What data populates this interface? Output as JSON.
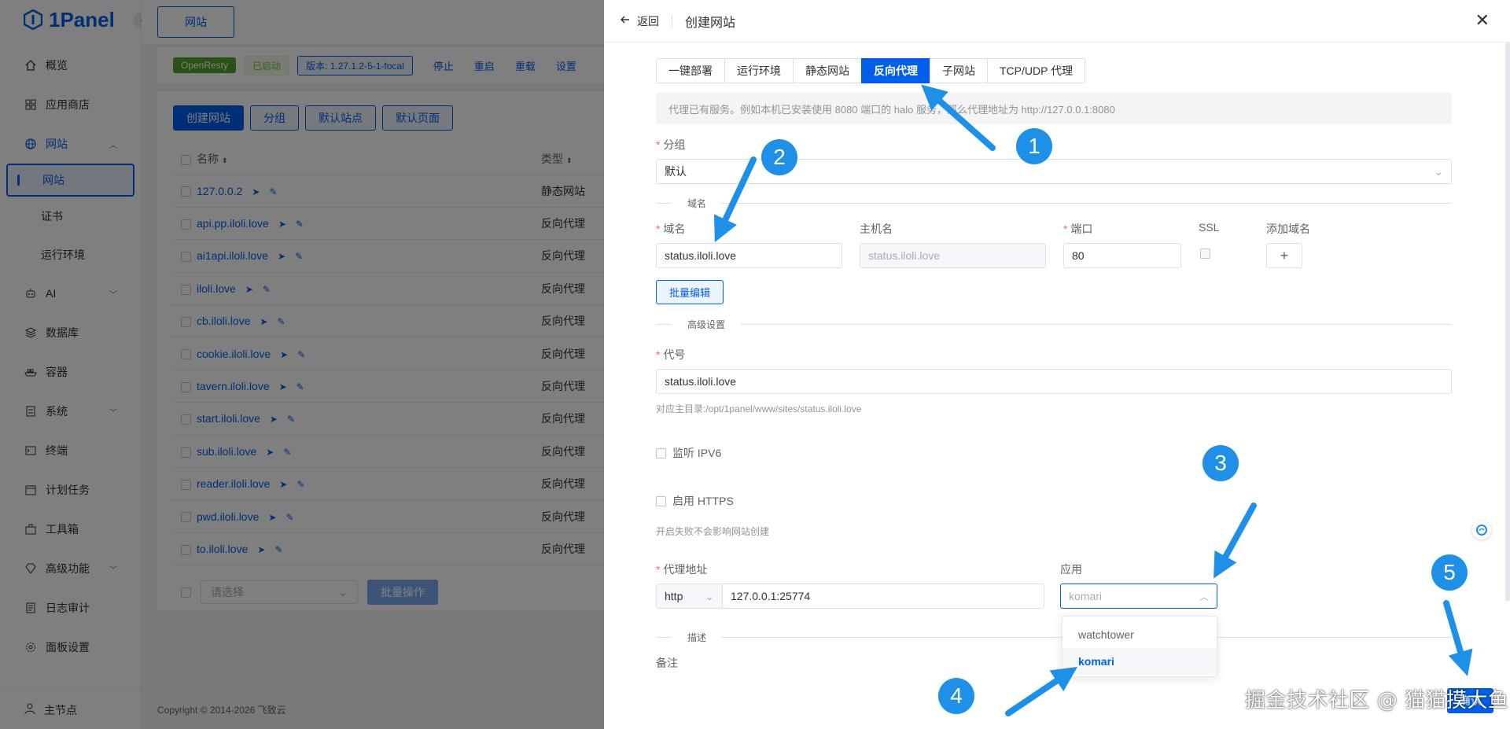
{
  "app": {
    "logo_text": "1Panel",
    "copyright": "Copyright © 2014-2026 飞致云"
  },
  "sidebar": {
    "items": [
      {
        "label": "概览",
        "icon": "home-icon"
      },
      {
        "label": "应用商店",
        "icon": "grid-icon"
      },
      {
        "label": "网站",
        "icon": "globe-icon"
      },
      {
        "label": "AI",
        "icon": "robot-icon"
      },
      {
        "label": "数据库",
        "icon": "layers-icon"
      },
      {
        "label": "容器",
        "icon": "ship-icon"
      },
      {
        "label": "系统",
        "icon": "system-icon"
      },
      {
        "label": "终端",
        "icon": "terminal-icon"
      },
      {
        "label": "计划任务",
        "icon": "calendar-icon"
      },
      {
        "label": "工具箱",
        "icon": "toolbox-icon"
      },
      {
        "label": "高级功能",
        "icon": "diamond-icon"
      },
      {
        "label": "日志审计",
        "icon": "log-icon"
      },
      {
        "label": "面板设置",
        "icon": "gear-icon"
      }
    ],
    "sub_items": [
      "网站",
      "证书",
      "运行环境"
    ],
    "bottom": "主节点"
  },
  "header_tab": "网站",
  "status_bar": {
    "openresty": "OpenResty",
    "state": "已启动",
    "version": "版本: 1.27.1.2-5-1-focal",
    "actions": [
      "停止",
      "重启",
      "重载",
      "设置"
    ]
  },
  "toolbar": {
    "create": "创建网站",
    "group": "分组",
    "default_site": "默认站点",
    "default_page": "默认页面"
  },
  "table": {
    "col_name": "名称",
    "col_type": "类型",
    "rows": [
      {
        "name": "127.0.0.2",
        "type": "静态网站"
      },
      {
        "name": "api.pp.iloli.love",
        "type": "反向代理"
      },
      {
        "name": "ai1api.iloli.love",
        "type": "反向代理"
      },
      {
        "name": "iloli.love",
        "type": "反向代理"
      },
      {
        "name": "cb.iloli.love",
        "type": "反向代理"
      },
      {
        "name": "cookie.iloli.love",
        "type": "反向代理"
      },
      {
        "name": "tavern.iloli.love",
        "type": "反向代理"
      },
      {
        "name": "start.iloli.love",
        "type": "反向代理"
      },
      {
        "name": "sub.iloli.love",
        "type": "反向代理"
      },
      {
        "name": "reader.iloli.love",
        "type": "反向代理"
      },
      {
        "name": "pwd.iloli.love",
        "type": "反向代理"
      },
      {
        "name": "to.iloli.love",
        "type": "反向代理"
      }
    ],
    "batch_placeholder": "请选择",
    "batch_button": "批量操作"
  },
  "drawer": {
    "back": "返回",
    "title": "创建网站",
    "tabs": [
      "一键部署",
      "运行环境",
      "静态网站",
      "反向代理",
      "子网站",
      "TCP/UDP 代理"
    ],
    "active_tab": 3,
    "alert": "代理已有服务。例如本机已安装使用 8080 端口的 halo 服务，那么代理地址为 http://127.0.0.1:8080",
    "group_label": "分组",
    "group_value": "默认",
    "section_domain": "域名",
    "domain_label": "域名",
    "domain_value": "status.iloli.love",
    "host_label": "主机名",
    "host_value": "status.iloli.love",
    "port_label": "端口",
    "port_value": "80",
    "ssl_label": "SSL",
    "add_domain_label": "添加域名",
    "batch_edit": "批量编辑",
    "section_advanced": "高级设置",
    "alias_label": "代号",
    "alias_value": "status.iloli.love",
    "alias_hint": "对应主目录:/opt/1panel/www/sites/status.iloli.love",
    "ipv6_label": "监听 IPV6",
    "https_label": "启用 HTTPS",
    "https_hint": "开启失败不会影响网站创建",
    "proxy_label": "代理地址",
    "proxy_scheme": "http",
    "proxy_value": "127.0.0.1:25774",
    "app_label": "应用",
    "app_placeholder": "komari",
    "app_options": [
      "watchtower",
      "komari"
    ],
    "section_desc": "描述",
    "remark_label": "备注",
    "confirm": "确认"
  },
  "annotations": [
    "1",
    "2",
    "3",
    "4",
    "5"
  ],
  "watermark": "掘金技术社区 @ 猫猫摸大鱼",
  "colors": {
    "primary": "#005eeb",
    "annotation": "#1e90e8",
    "required": "#f56c6c"
  }
}
